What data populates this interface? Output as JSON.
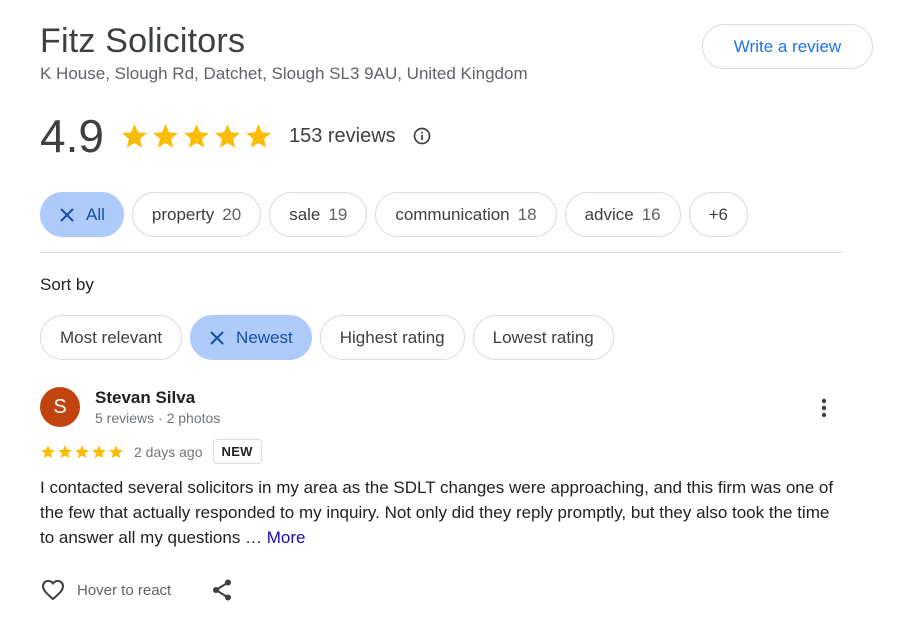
{
  "business": {
    "name": "Fitz Solicitors",
    "address": "K House, Slough Rd, Datchet, Slough SL3 9AU, United Kingdom",
    "write_review_label": "Write a review"
  },
  "rating": {
    "value": "4.9",
    "stars": 5,
    "reviews_label": "153 reviews",
    "star_color": "#fbbc04"
  },
  "topics": [
    {
      "label": "All",
      "count": "",
      "selected": true
    },
    {
      "label": "property",
      "count": "20",
      "selected": false
    },
    {
      "label": "sale",
      "count": "19",
      "selected": false
    },
    {
      "label": "communication",
      "count": "18",
      "selected": false
    },
    {
      "label": "advice",
      "count": "16",
      "selected": false
    },
    {
      "label": "+6",
      "count": "",
      "selected": false
    }
  ],
  "sort": {
    "label": "Sort by",
    "options": [
      {
        "label": "Most relevant",
        "selected": false
      },
      {
        "label": "Newest",
        "selected": true
      },
      {
        "label": "Highest rating",
        "selected": false
      },
      {
        "label": "Lowest rating",
        "selected": false
      }
    ]
  },
  "review": {
    "avatar_initial": "S",
    "avatar_color": "#c1440e",
    "name": "Stevan Silva",
    "meta": "5 reviews · 2 photos",
    "stars": 5,
    "date": "2 days ago",
    "badge": "NEW",
    "text": "I contacted several solicitors in my area as the SDLT changes were approaching, and this firm was one of the few that actually responded to my inquiry. Not only did they reply promptly, but they also took the time to answer all my questions … ",
    "more_label": "More",
    "react_label": "Hover to react"
  },
  "colors": {
    "accent_blue": "#1a73e8",
    "selected_chip_bg": "#aecbfa",
    "link": "#1a0dab"
  }
}
